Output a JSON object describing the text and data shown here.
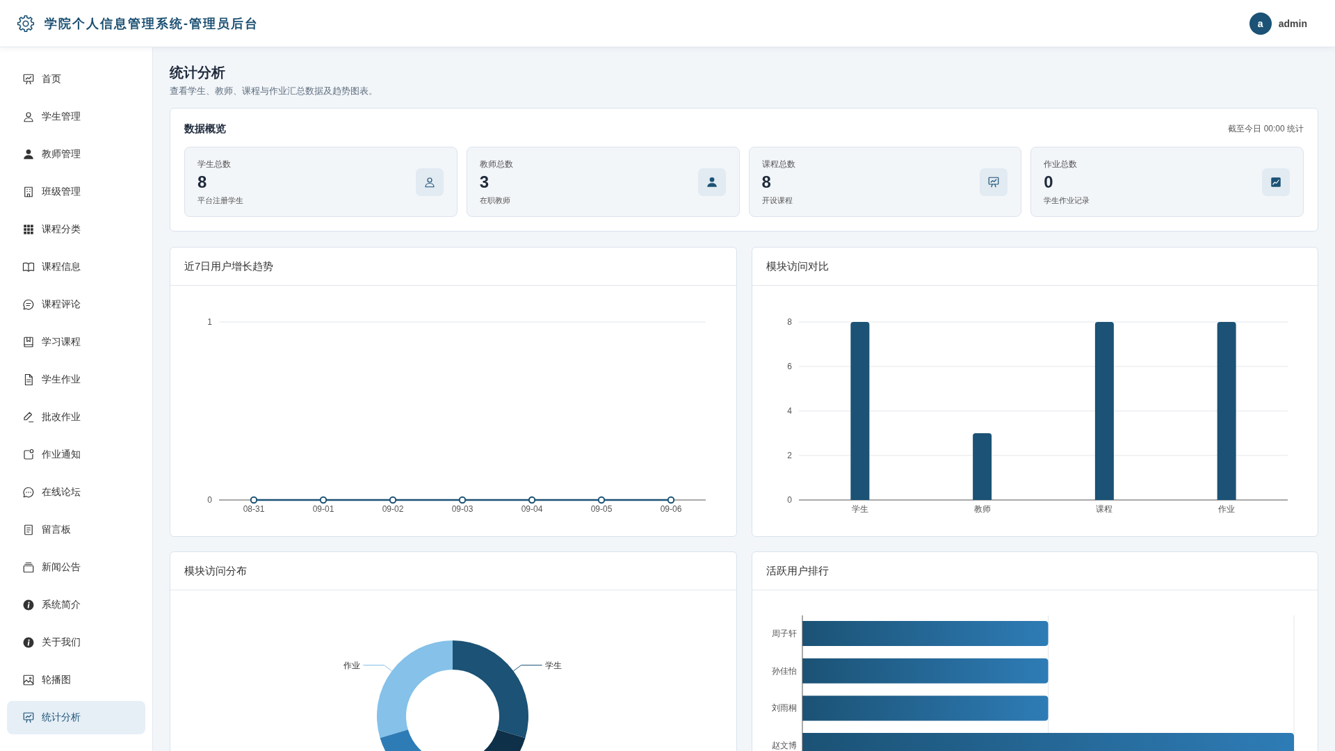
{
  "header": {
    "title": "学院个人信息管理系统-管理员后台",
    "avatar_letter": "a",
    "username": "admin"
  },
  "sidebar": {
    "items": [
      {
        "label": "首页",
        "selected": false
      },
      {
        "label": "学生管理",
        "selected": false
      },
      {
        "label": "教师管理",
        "selected": false
      },
      {
        "label": "班级管理",
        "selected": false
      },
      {
        "label": "课程分类",
        "selected": false
      },
      {
        "label": "课程信息",
        "selected": false
      },
      {
        "label": "课程评论",
        "selected": false
      },
      {
        "label": "学习课程",
        "selected": false
      },
      {
        "label": "学生作业",
        "selected": false
      },
      {
        "label": "批改作业",
        "selected": false
      },
      {
        "label": "作业通知",
        "selected": false
      },
      {
        "label": "在线论坛",
        "selected": false
      },
      {
        "label": "留言板",
        "selected": false
      },
      {
        "label": "新闻公告",
        "selected": false
      },
      {
        "label": "系统简介",
        "selected": false
      },
      {
        "label": "关于我们",
        "selected": false
      },
      {
        "label": "轮播图",
        "selected": false
      },
      {
        "label": "统计分析",
        "selected": true
      }
    ]
  },
  "page": {
    "title": "统计分析",
    "subtitle": "查看学生、教师、课程与作业汇总数据及趋势图表。"
  },
  "overview": {
    "title": "数据概览",
    "note": "截至今日 00:00 统计",
    "stats": [
      {
        "label": "学生总数",
        "value": "8",
        "note": "平台注册学生"
      },
      {
        "label": "教师总数",
        "value": "3",
        "note": "在职教师"
      },
      {
        "label": "课程总数",
        "value": "8",
        "note": "开设课程"
      },
      {
        "label": "作业总数",
        "value": "0",
        "note": "学生作业记录"
      }
    ]
  },
  "user_trend": {
    "title": "近7日用户增长趋势",
    "chart_data": {
      "type": "line",
      "categories": [
        "08-31",
        "09-01",
        "09-02",
        "09-03",
        "09-04",
        "09-05",
        "09-06"
      ],
      "series": [
        {
          "color": "#1b5275",
          "marker": true,
          "values": [
            0,
            0,
            0,
            0,
            0,
            0,
            0
          ]
        }
      ],
      "ylim": [
        0,
        1
      ],
      "yticks": [
        0,
        1
      ],
      "grid": true
    }
  },
  "module_visits": {
    "title": "模块访问对比",
    "chart_data": {
      "type": "bar",
      "categories": [
        "学生",
        "教师",
        "课程",
        "作业"
      ],
      "series": [
        {
          "color": "#1b5275",
          "values": [
            8,
            3,
            8,
            8
          ]
        }
      ],
      "ylim": [
        0,
        8
      ],
      "yticks": [
        0,
        2,
        4,
        6,
        8
      ],
      "grid": true
    }
  },
  "module_share": {
    "title": "模块访问分布",
    "slices": [
      {
        "label": "作业",
        "color": "#85c1e9"
      },
      {
        "color": "#2e7cb6"
      },
      {
        "color": "#0f3049"
      },
      {
        "label": "学生",
        "color": "#1b5275"
      }
    ]
  },
  "active_users": {
    "title": "活跃用户排行",
    "users": [
      "周子轩",
      "孙佳怡",
      "刘雨桐",
      "赵文博"
    ]
  }
}
